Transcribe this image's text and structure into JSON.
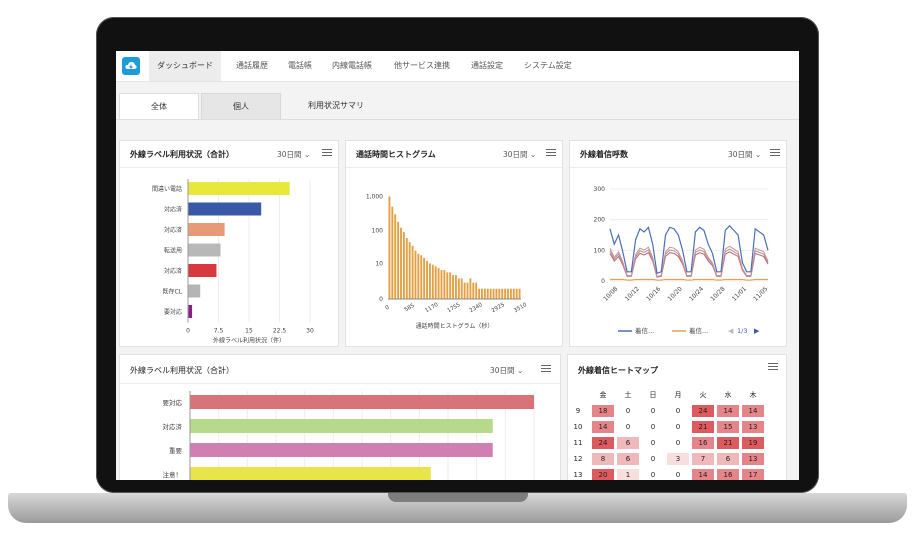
{
  "nav": {
    "items": [
      "ダッシュボード",
      "通話履歴",
      "電話帳",
      "内線電話帳",
      "他サービス連携",
      "通話設定",
      "システム設定"
    ]
  },
  "tabs": [
    "全体",
    "個人",
    "利用状況サマリ"
  ],
  "period_label": "30日間",
  "card1": {
    "title": "外線ラベル利用状況（合計）",
    "chart_data": {
      "type": "bar",
      "orientation": "horizontal",
      "categories": [
        "間違い電話",
        "対応済",
        "対応済",
        "転送用",
        "対応済",
        "既存CL",
        "要対応"
      ],
      "values": [
        25,
        18,
        9,
        8,
        7,
        3,
        1
      ],
      "colors": [
        "#e8e83a",
        "#3a57a8",
        "#e89a78",
        "#b8b8b8",
        "#d9383f",
        "#b5b5b5",
        "#8e1d8c"
      ],
      "xticks": [
        "0",
        "7.5",
        "15",
        "22.5",
        "30"
      ],
      "xlim": [
        0,
        30
      ],
      "xlabel": "外線ラベル利用状況（件）"
    }
  },
  "card2": {
    "title": "通話時間ヒストグラム",
    "chart_data": {
      "type": "bar",
      "scale": "log",
      "yticks": [
        "1,000",
        "100",
        "10",
        "0"
      ],
      "xticks": [
        "0",
        "585",
        "1170",
        "1755",
        "2340",
        "2925",
        "3510"
      ],
      "values": [
        1000,
        500,
        300,
        180,
        120,
        90,
        60,
        45,
        35,
        25,
        20,
        18,
        15,
        12,
        10,
        9,
        8,
        7,
        6,
        6,
        5,
        5,
        4,
        4,
        3,
        3,
        2,
        2,
        3,
        2,
        2,
        1,
        1,
        1,
        1,
        1,
        1,
        1,
        1,
        1,
        1,
        1,
        1,
        1,
        1,
        1
      ],
      "xlabel": "通話時間ヒストグラム（秒）",
      "color": "#e3a043"
    }
  },
  "card3": {
    "title": "外線着信呼数",
    "chart_data": {
      "type": "line",
      "yticks": [
        "300",
        "200",
        "100",
        "0"
      ],
      "ylim": [
        0,
        300
      ],
      "xticks": [
        "10/08",
        "10/12",
        "10/16",
        "10/20",
        "10/24",
        "10/28",
        "11/01",
        "11/05"
      ],
      "series": [
        {
          "name": "着信...",
          "color": "#4a6fb5",
          "values": [
            170,
            120,
            150,
            95,
            30,
            30,
            135,
            170,
            160,
            175,
            120,
            25,
            30,
            150,
            175,
            170,
            150,
            100,
            30,
            30,
            160,
            175,
            165,
            120,
            90,
            30,
            30,
            165,
            180,
            165,
            150,
            60,
            30,
            30,
            170,
            160,
            150,
            100
          ]
        },
        {
          "name": "着信...",
          "color": "#e7a05a",
          "values": [
            5,
            5,
            5,
            5,
            3,
            3,
            5,
            5,
            5,
            5,
            5,
            3,
            3,
            5,
            5,
            5,
            5,
            5,
            3,
            3,
            5,
            5,
            5,
            5,
            5,
            3,
            3,
            5,
            5,
            5,
            5,
            5,
            3,
            3,
            5,
            5,
            5,
            5
          ]
        }
      ],
      "extra_series_colors": [
        "#c75b6b",
        "#9c9c9c",
        "#d08f93"
      ],
      "legend_page": "1/3"
    }
  },
  "card4": {
    "title": "外線ラベル利用状況（合計）",
    "chart_data": {
      "type": "bar",
      "orientation": "horizontal",
      "categories": [
        "要対応",
        "対応済",
        "重要",
        "注意！"
      ],
      "values": [
        100,
        88,
        88,
        70
      ],
      "colors": [
        "#d77379",
        "#b6d98b",
        "#d17fb1",
        "#e8e54b"
      ]
    }
  },
  "card5": {
    "title": "外線着信ヒートマップ",
    "days": [
      "金",
      "土",
      "日",
      "月",
      "火",
      "水",
      "木"
    ],
    "hours": [
      "9",
      "10",
      "11",
      "12",
      "13"
    ],
    "rows": [
      [
        "18",
        "0",
        "0",
        "0",
        "24",
        "14",
        "14"
      ],
      [
        "14",
        "0",
        "0",
        "0",
        "21",
        "15",
        "13"
      ],
      [
        "24",
        "6",
        "0",
        "0",
        "16",
        "21",
        "19"
      ],
      [
        "8",
        "6",
        "0",
        "3",
        "7",
        "6",
        "13"
      ],
      [
        "20",
        "1",
        "0",
        "0",
        "14",
        "16",
        "17"
      ]
    ]
  }
}
